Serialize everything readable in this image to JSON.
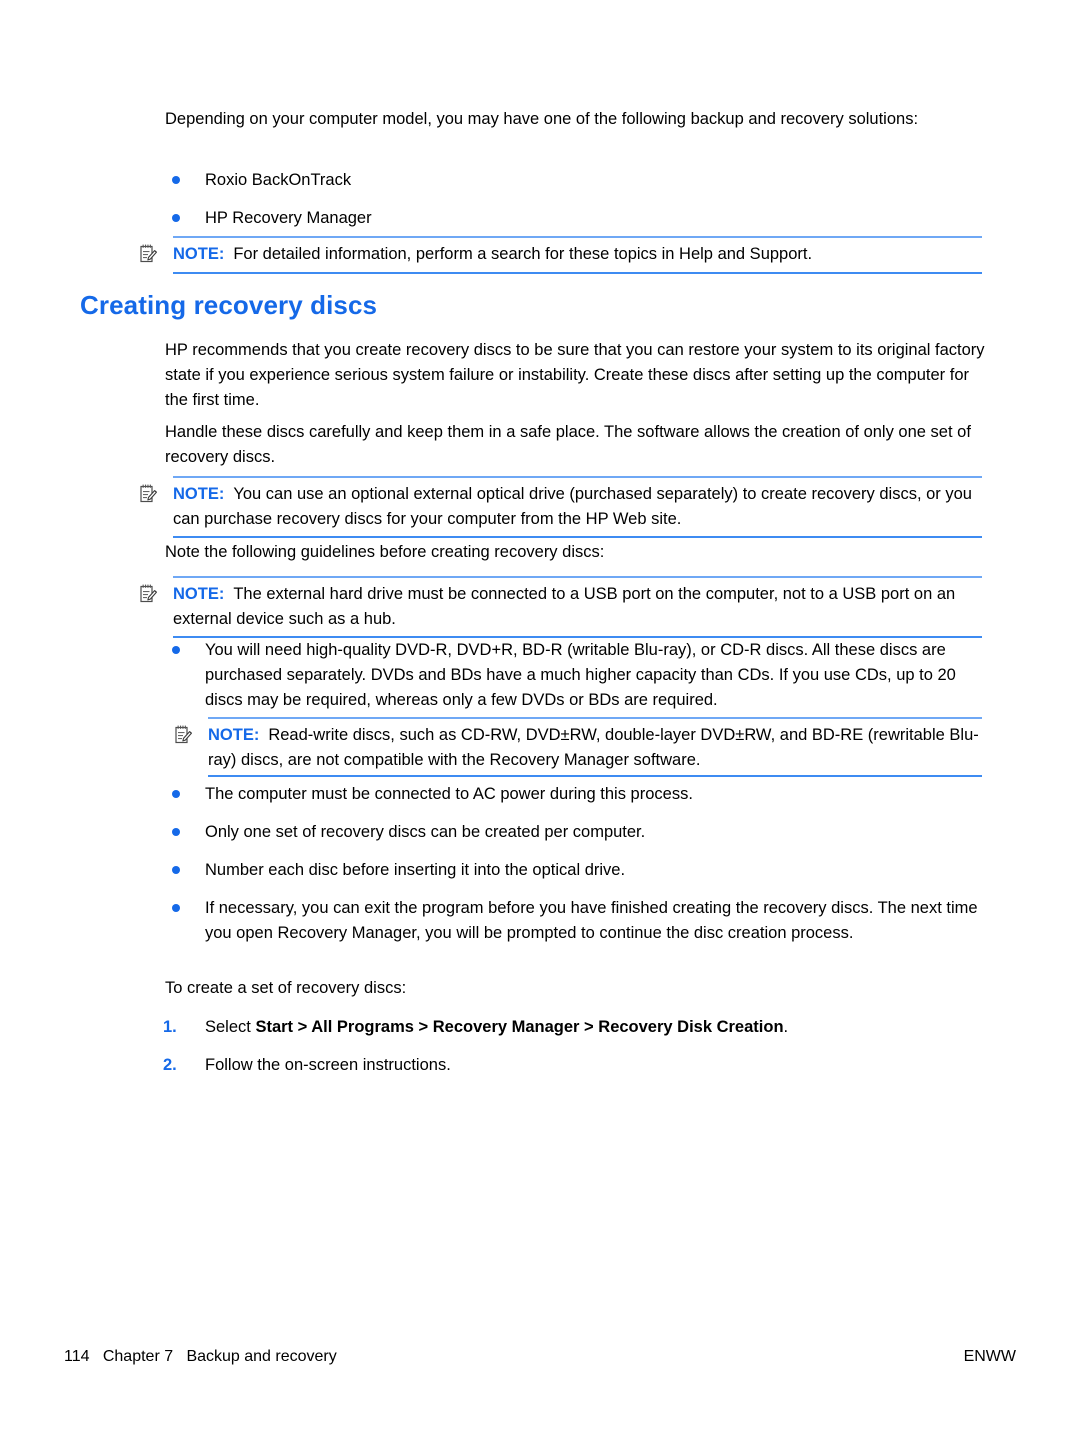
{
  "document": {
    "intro_paragraph": "Depending on your computer model, you may have one of the following backup and recovery solutions:",
    "solutions_bullets": [
      "Roxio BackOnTrack",
      "HP Recovery Manager"
    ],
    "note_1": {
      "label": "NOTE:",
      "text": "For detailed information, perform a search for these topics in Help and Support.",
      "icon": "note-pencil-icon"
    },
    "heading": "Creating recovery discs",
    "paragraph_1": "HP recommends that you create recovery discs to be sure that you can restore your system to its original factory state if you experience serious system failure or instability. Create these discs after setting up the computer for the first time.",
    "paragraph_2": "Handle these discs carefully and keep them in a safe place. The software allows the creation of only one set of recovery discs.",
    "note_2": {
      "label": "NOTE:",
      "text": "You can use an optional external optical drive (purchased separately) to create recovery discs, or you can purchase recovery discs for your computer from the HP Web site.",
      "icon": "note-pencil-icon"
    },
    "paragraph_3": "Note the following guidelines before creating recovery discs:",
    "note_3": {
      "label": "NOTE:",
      "text": "The external hard drive must be connected to a USB port on the computer, not to a USB port on an external device such as a hub.",
      "icon": "note-pencil-icon"
    },
    "guideline_bullet_1": "You will need high-quality DVD-R, DVD+R, BD-R (writable Blu-ray), or CD-R discs. All these discs are purchased separately. DVDs and BDs have a much higher capacity than CDs. If you use CDs, up to 20 discs may be required, whereas only a few DVDs or BDs are required.",
    "note_4": {
      "label": "NOTE:",
      "text": "Read-write discs, such as CD-RW, DVD±RW, double-layer DVD±RW, and BD-RE (rewritable Blu-ray) discs, are not compatible with the Recovery Manager software.",
      "icon": "note-pencil-icon"
    },
    "guideline_bullets": [
      "The computer must be connected to AC power during this process.",
      "Only one set of recovery discs can be created per computer.",
      "Number each disc before inserting it into the optical drive.",
      "If necessary, you can exit the program before you have finished creating the recovery discs. The next time you open Recovery Manager, you will be prompted to continue the disc creation process."
    ],
    "paragraph_4": "To create a set of recovery discs:",
    "steps": [
      {
        "marker": "1.",
        "prefix": "Select ",
        "bold": "Start > All Programs > Recovery Manager > Recovery Disk Creation",
        "suffix": "."
      },
      {
        "marker": "2.",
        "prefix": "Follow the on-screen instructions.",
        "bold": "",
        "suffix": ""
      }
    ],
    "footer": {
      "left": "114   Chapter 7   Backup and recovery",
      "right": "ENWW"
    },
    "colors": {
      "heading_blue": "#1569e8",
      "bullet_blue": "#1569e8",
      "note_rule_top": "#6fa8f5",
      "note_rule_bottom": "#3d8bf2",
      "text_black": "#000000"
    }
  }
}
